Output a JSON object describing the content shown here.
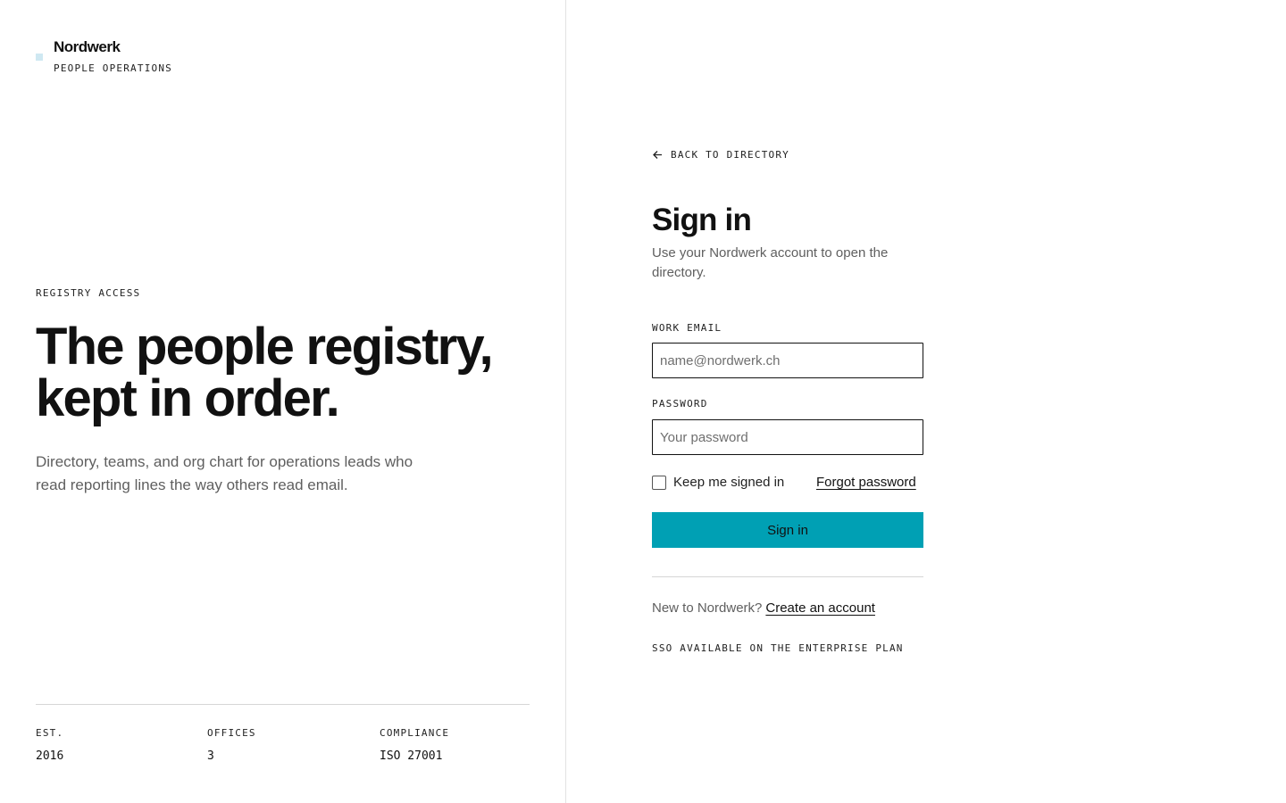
{
  "brand": {
    "name": "Nordwerk",
    "subtitle": "PEOPLE OPERATIONS",
    "mark_color": "#cfe8f2"
  },
  "hero": {
    "eyebrow": "REGISTRY ACCESS",
    "title_line1": "The people registry,",
    "title_line2": "kept in order.",
    "subtitle": "Directory, teams, and org chart for operations leads who read reporting lines the way others read email."
  },
  "stats": [
    {
      "label": "EST.",
      "value": "2016"
    },
    {
      "label": "OFFICES",
      "value": "3"
    },
    {
      "label": "COMPLIANCE",
      "value": "ISO 27001"
    }
  ],
  "signin": {
    "back_label": "BACK TO DIRECTORY",
    "back_icon": "arrow-left-icon",
    "title": "Sign in",
    "subtitle": "Use your Nordwerk account to open the directory.",
    "email_label": "WORK EMAIL",
    "email_placeholder": "name@nordwerk.ch",
    "password_label": "PASSWORD",
    "password_placeholder": "Your password",
    "remember_label": "Keep me signed in",
    "remember_checked": false,
    "forgot_label": "Forgot password",
    "submit_label": "Sign in",
    "submit_color": "#00a0b4",
    "signup_prompt": "New to Nordwerk?",
    "signup_link": "Create an account",
    "sso_note": "SSO AVAILABLE ON THE ENTERPRISE PLAN"
  }
}
